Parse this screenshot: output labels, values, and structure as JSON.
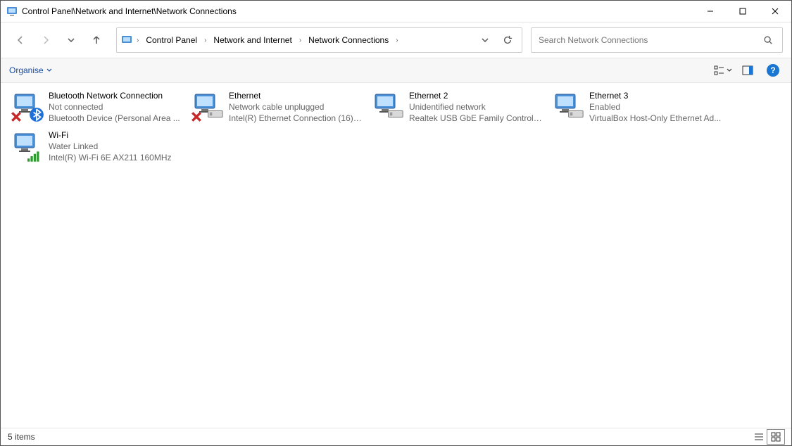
{
  "window": {
    "title": "Control Panel\\Network and Internet\\Network Connections"
  },
  "breadcrumb": {
    "root": "Control Panel",
    "mid": "Network and Internet",
    "leaf": "Network Connections"
  },
  "search": {
    "placeholder": "Search Network Connections"
  },
  "cmdbar": {
    "organise": "Organise"
  },
  "connections": [
    {
      "name": "Bluetooth Network Connection",
      "status": "Not connected",
      "device": "Bluetooth Device (Personal Area ...",
      "icon": "bluetooth",
      "error": true
    },
    {
      "name": "Ethernet",
      "status": "Network cable unplugged",
      "device": "Intel(R) Ethernet Connection (16) ...",
      "icon": "ethernet",
      "error": true
    },
    {
      "name": "Ethernet 2",
      "status": "Unidentified network",
      "device": "Realtek USB GbE Family Controller",
      "icon": "ethernet",
      "error": false
    },
    {
      "name": "Ethernet 3",
      "status": "Enabled",
      "device": "VirtualBox Host-Only Ethernet Ad...",
      "icon": "ethernet",
      "error": false
    },
    {
      "name": "Wi-Fi",
      "status": "Water Linked",
      "device": "Intel(R) Wi-Fi 6E AX211 160MHz",
      "icon": "wifi",
      "error": false
    }
  ],
  "status": {
    "count_text": "5 items"
  }
}
